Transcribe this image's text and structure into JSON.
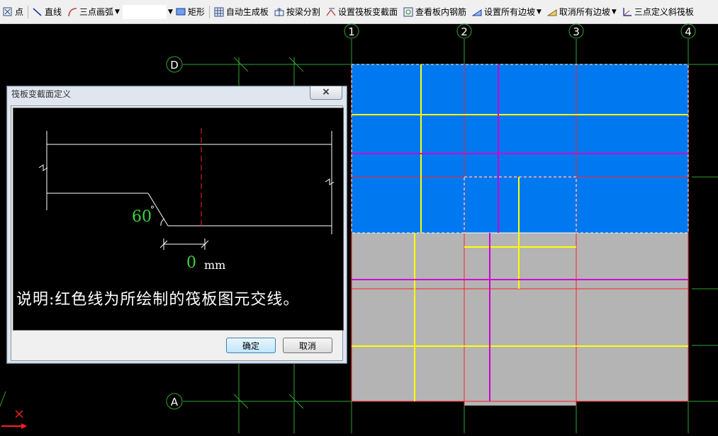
{
  "toolbar": {
    "point": "点",
    "line": "直线",
    "arc": "三点画弧",
    "rect": "矩形",
    "auto_slab": "自动生成板",
    "split_by_beam": "按梁分割",
    "set_section": "设置筏板变截面",
    "view_rebar": "查看板内钢筋",
    "set_all_slope": "设置所有边坡",
    "cancel_all_slope": "取消所有边坡",
    "three_point_slope": "三点定义斜筏板"
  },
  "axes": {
    "x": [
      "1",
      "2",
      "3",
      "4"
    ],
    "y": [
      "D",
      "A"
    ]
  },
  "dialog": {
    "title": "筏板变截面定义",
    "close": "×",
    "angle_value": "60",
    "angle_unit": "°",
    "offset_value": "0",
    "offset_unit": "mm",
    "note": "说明:红色线为所绘制的筏板图元交线。",
    "ok": "确定",
    "cancel": "取消"
  },
  "colors": {
    "slab_blue": "#0078f0",
    "slab_gray": "#b4b4b4",
    "axis_green": "#2fa52f",
    "beam_yellow": "#ffff00",
    "beam_magenta": "#d000d0",
    "boundary_red": "#ff2020"
  }
}
